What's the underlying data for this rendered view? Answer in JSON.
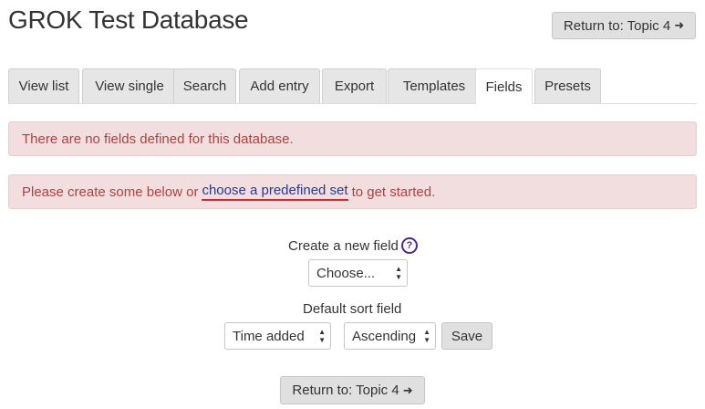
{
  "page": {
    "title": "GROK Test Database",
    "return_label": "Return to: Topic 4",
    "return_icon": "sign-in-arrow-icon"
  },
  "tabs": [
    {
      "label": "View list",
      "active": false
    },
    {
      "label": "View single",
      "active": false
    },
    {
      "label": "Search",
      "active": false
    },
    {
      "label": "Add entry",
      "active": false
    },
    {
      "label": "Export",
      "active": false
    },
    {
      "label": "Templates",
      "active": false
    },
    {
      "label": "Fields",
      "active": true
    },
    {
      "label": "Presets",
      "active": false
    }
  ],
  "alerts": {
    "no_fields": "There are no fields defined for this database.",
    "create_prefix": "Please create some below or",
    "create_link": "choose a predefined set",
    "create_suffix": "to get started."
  },
  "new_field": {
    "label": "Create a new field",
    "help_icon": "question-circle-icon",
    "selected": "Choose..."
  },
  "sort": {
    "label": "Default sort field",
    "field_selected": "Time added",
    "order_selected": "Ascending",
    "save_label": "Save"
  },
  "colors": {
    "alert_bg": "#f2dede",
    "alert_text": "#a94442",
    "link": "#2a3a8c",
    "link_underline": "#e3232a",
    "button_bg": "#e0e0e0"
  }
}
